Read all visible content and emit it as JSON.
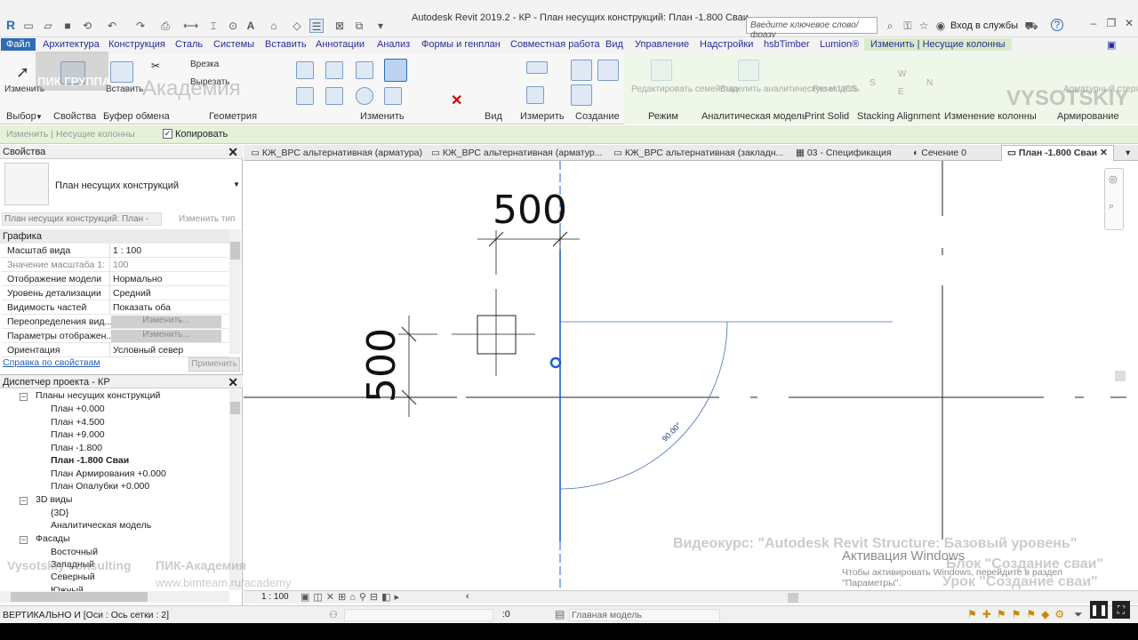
{
  "window": {
    "title": "Autodesk Revit 2019.2 - КР - План несущих конструкций: План -1.800 Сваи",
    "search_placeholder": "Введите ключевое слово/фразу",
    "signin": "Вход в службы"
  },
  "ribbon_tabs": [
    "Файл",
    "Архитектура",
    "Конструкция",
    "Сталь",
    "Системы",
    "Вставить",
    "Аннотации",
    "Анализ",
    "Формы и генплан",
    "Совместная работа",
    "Вид",
    "Управление",
    "Надстройки",
    "hsbTimber",
    "Lumion®",
    "Изменить | Несущие колонны"
  ],
  "ribbon": {
    "select_btn": "Изменить",
    "paste_btn": "Вставить",
    "cut_btn": "Врезка",
    "cut2_btn": "Вырезать",
    "panels": {
      "select": "Выбор",
      "properties": "Свойства",
      "clipboard": "Буфер обмена",
      "geometry": "Геометрия",
      "modify": "Изменить",
      "view": "Вид",
      "measure": "Измерить",
      "create": "Создание",
      "mode": "Режим",
      "analytical": "Аналитическая модель",
      "print_solid": "Print Solid",
      "stacking": "Stacking Alignment",
      "change_columns": "Изменение колонны",
      "rebar": "Армирование"
    },
    "edit_family": "Редактировать семейство",
    "select_analytical": "Выделить аналитическую модель",
    "reset_ucs": "Reset UCS",
    "compass": {
      "w": "W",
      "s": "S",
      "e": "E",
      "n": "N"
    },
    "rebar_cover": "Арматурный стержень"
  },
  "optionsbar": {
    "context": "Изменить | Несущие колонны",
    "copy_label": "Копировать",
    "copy_checked": true
  },
  "properties": {
    "title": "Свойства",
    "type_name": "План несущих конструкций",
    "instance_filter": "План несущих конструкций: План -",
    "edit_type": "Изменить тип",
    "group": "Графика",
    "rows": [
      {
        "k": "Масштаб вида",
        "v": "1 : 100"
      },
      {
        "k": "Значение масштаба   1:",
        "v": "100"
      },
      {
        "k": "Отображение модели",
        "v": "Нормально"
      },
      {
        "k": "Уровень детализации",
        "v": "Средний"
      },
      {
        "k": "Видимость частей",
        "v": "Показать оба"
      },
      {
        "k": "Переопределения вид...",
        "v": "Изменить..."
      },
      {
        "k": "Параметры отображен...",
        "v": "Изменить..."
      },
      {
        "k": "Ориентация",
        "v": "Условный север"
      }
    ],
    "help_link": "Справка по свойствам",
    "apply": "Применить"
  },
  "browser": {
    "title": "Диспетчер проекта - КР",
    "items": [
      {
        "label": "Планы несущих конструкций",
        "level": 1,
        "toggle": "-"
      },
      {
        "label": "План +0.000",
        "level": 2
      },
      {
        "label": "План +4.500",
        "level": 2
      },
      {
        "label": "План +9.000",
        "level": 2
      },
      {
        "label": "План -1.800",
        "level": 2
      },
      {
        "label": "План -1.800 Сваи",
        "level": 2,
        "bold": true
      },
      {
        "label": "План Армирования +0.000",
        "level": 2
      },
      {
        "label": "План Опалубки +0.000",
        "level": 2
      },
      {
        "label": "3D виды",
        "level": 1,
        "toggle": "-"
      },
      {
        "label": "{3D}",
        "level": 2
      },
      {
        "label": "Аналитическая модель",
        "level": 2
      },
      {
        "label": "Фасады",
        "level": 1,
        "toggle": "-"
      },
      {
        "label": "Восточный",
        "level": 2
      },
      {
        "label": "Западный",
        "level": 2
      },
      {
        "label": "Северный",
        "level": 2
      },
      {
        "label": "Южный",
        "level": 2
      }
    ]
  },
  "view_tabs": [
    {
      "label": "КЖ_ВРС альтернативная (арматура)"
    },
    {
      "label": "КЖ_ВРС альтернативная (арматур..."
    },
    {
      "label": "КЖ_ВРС альтернативная (закладн..."
    },
    {
      "label": "03 - Спецификация"
    },
    {
      "label": "Сечение 0"
    },
    {
      "label": "План -1.800 Сваи",
      "active": true
    }
  ],
  "canvas": {
    "dim_top": "500",
    "dim_left": "500",
    "angle": "90.00°"
  },
  "viewbar": {
    "scale": "1 : 100"
  },
  "statusbar": {
    "message": "ВЕРТИКАЛЬНО И [Оси : Ось сетки : 2]",
    "count": ":0",
    "model": "Главная модель"
  },
  "watermarks": {
    "logo": "ПИК ГРУППА",
    "academy": "Академия",
    "vysotskiy": "VYSOTSKIY",
    "consulting": "Vysotskiy consulting",
    "pik_academy": "ПИК-Академия",
    "url1": "www.bimteam.ru/academy",
    "course": "Видеокурс: \"Autodesk Revit Structure: Базовый уровень\"",
    "block": "Блок \"Создание сваи\"",
    "lesson": "Урок \"Создание сваи\"",
    "activation_title": "Активация Windows",
    "activation_text": "Чтобы активировать Windows, перейдите в раздел \"Параметры\"."
  },
  "colors": {
    "file_tab": "#2d6bb5",
    "context_tab": "#d7ecc9",
    "selection_blue": "#1f5fd0"
  }
}
